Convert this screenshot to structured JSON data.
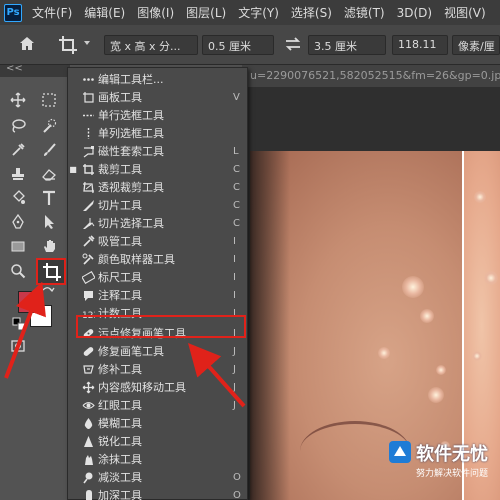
{
  "app": {
    "logo_text": "Ps"
  },
  "menubar": {
    "items": [
      "文件(F)",
      "编辑(E)",
      "图像(I)",
      "图层(L)",
      "文字(Y)",
      "选择(S)",
      "滤镜(T)",
      "3D(D)",
      "视图(V)"
    ]
  },
  "options": {
    "ratio_label": "宽 x 高 x 分...",
    "width_value": "0.5 厘米",
    "height_value": "3.5 厘米",
    "resolution_value": "118.11",
    "unit_value": "像素/厘"
  },
  "tools_panel": {
    "collapse_label": "<<"
  },
  "document": {
    "tab_title": "u=2290076521,582052515&fm=26&gp=0.jpg"
  },
  "flyout": {
    "items": [
      {
        "label": "编辑工具栏...",
        "key": "",
        "icon": "dots-icon",
        "current": false
      },
      {
        "label": "画板工具",
        "key": "V",
        "icon": "artboard-icon",
        "current": false
      },
      {
        "label": "单行选框工具",
        "key": "",
        "icon": "single-row-marquee-icon",
        "current": false
      },
      {
        "label": "单列选框工具",
        "key": "",
        "icon": "single-column-marquee-icon",
        "current": false
      },
      {
        "label": "磁性套索工具",
        "key": "L",
        "icon": "magnetic-lasso-icon",
        "current": false
      },
      {
        "label": "裁剪工具",
        "key": "C",
        "icon": "crop-icon",
        "current": true
      },
      {
        "label": "透视裁剪工具",
        "key": "C",
        "icon": "perspective-crop-icon",
        "current": false
      },
      {
        "label": "切片工具",
        "key": "C",
        "icon": "slice-icon",
        "current": false
      },
      {
        "label": "切片选择工具",
        "key": "C",
        "icon": "slice-select-icon",
        "current": false
      },
      {
        "label": "吸管工具",
        "key": "I",
        "icon": "eyedropper-icon",
        "current": false
      },
      {
        "label": "颜色取样器工具",
        "key": "I",
        "icon": "color-sampler-icon",
        "current": false
      },
      {
        "label": "标尺工具",
        "key": "I",
        "icon": "ruler-icon",
        "current": false
      },
      {
        "label": "注释工具",
        "key": "I",
        "icon": "note-icon",
        "current": false
      },
      {
        "label": "计数工具",
        "key": "I",
        "icon": "count-icon",
        "current": false
      },
      {
        "label": "污点修复画笔工具",
        "key": "J",
        "icon": "spot-healing-brush-icon",
        "current": false
      },
      {
        "label": "修复画笔工具",
        "key": "J",
        "icon": "healing-brush-icon",
        "current": false
      },
      {
        "label": "修补工具",
        "key": "J",
        "icon": "patch-icon",
        "current": false
      },
      {
        "label": "内容感知移动工具",
        "key": "J",
        "icon": "content-aware-move-icon",
        "current": false
      },
      {
        "label": "红眼工具",
        "key": "J",
        "icon": "red-eye-icon",
        "current": false
      },
      {
        "label": "模糊工具",
        "key": "",
        "icon": "blur-icon",
        "current": false
      },
      {
        "label": "锐化工具",
        "key": "",
        "icon": "sharpen-icon",
        "current": false
      },
      {
        "label": "涂抹工具",
        "key": "",
        "icon": "smudge-icon",
        "current": false
      },
      {
        "label": "减淡工具",
        "key": "O",
        "icon": "dodge-icon",
        "current": false
      },
      {
        "label": "加深工具",
        "key": "O",
        "icon": "burn-icon",
        "current": false
      }
    ]
  },
  "colors": {
    "foreground": "#c8384a",
    "background": "#ffffff",
    "highlight_red": "#e0221a"
  },
  "watermark": {
    "title": "软件无忧",
    "subtitle": "努力解决软件问题"
  }
}
